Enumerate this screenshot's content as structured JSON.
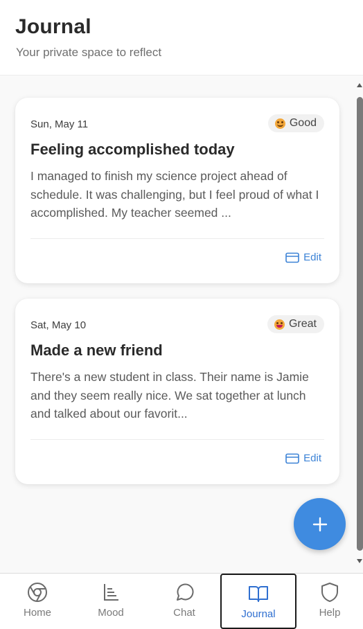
{
  "header": {
    "title": "Journal",
    "subtitle": "Your private space to reflect"
  },
  "entries": [
    {
      "date": "Sun, May 11",
      "mood": "Good",
      "mood_icon": "smiling-face-icon",
      "title": "Feeling accomplished today",
      "excerpt": "I managed to finish my science project ahead of schedule. It was challenging, but I feel proud of what I accomplished. My teacher seemed ...",
      "edit_label": "Edit"
    },
    {
      "date": "Sat, May 10",
      "mood": "Great",
      "mood_icon": "grinning-face-icon",
      "title": "Made a new friend",
      "excerpt": "There's a new student in class. Their name is Jamie and they seem really nice. We sat together at lunch and talked about our favorit...",
      "edit_label": "Edit"
    }
  ],
  "fab": {
    "icon": "plus-icon"
  },
  "nav": {
    "items": [
      {
        "label": "Home",
        "icon": "home-icon"
      },
      {
        "label": "Mood",
        "icon": "chart-icon"
      },
      {
        "label": "Chat",
        "icon": "chat-bubble-icon"
      },
      {
        "label": "Journal",
        "icon": "book-icon",
        "active": true
      },
      {
        "label": "Help",
        "icon": "shield-icon"
      }
    ]
  },
  "colors": {
    "accent": "#3f8be0",
    "link": "#3b82d6",
    "active_label": "#2f6fd0",
    "emoji": "#f3a83b"
  }
}
